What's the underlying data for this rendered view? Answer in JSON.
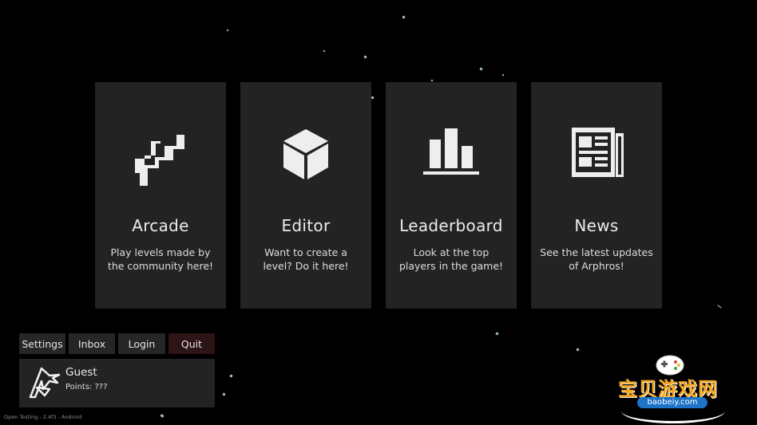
{
  "menu": {
    "cards": [
      {
        "title": "Arcade",
        "desc": "Play levels made by the community here!",
        "icon": "arcade-runner-icon"
      },
      {
        "title": "Editor",
        "desc": "Want to create a level? Do it here!",
        "icon": "cube-icon"
      },
      {
        "title": "Leaderboard",
        "desc": "Look at the top players in the game!",
        "icon": "bar-chart-icon"
      },
      {
        "title": "News",
        "desc": "See the latest updates of Arphros!",
        "icon": "newspaper-icon"
      }
    ]
  },
  "toolbar": {
    "settings_label": "Settings",
    "inbox_label": "Inbox",
    "login_label": "Login",
    "quit_label": "Quit"
  },
  "profile": {
    "name": "Guest",
    "points": "Points: ???",
    "avatar_icon": "arphros-logo-icon"
  },
  "footer": {
    "version": "Open Testing - 2.4f3 - Android"
  },
  "watermark": {
    "title": "宝贝游戏网",
    "domain": "baobeiy.com",
    "icon": "gamepad-icon"
  },
  "colors": {
    "background": "#000000",
    "card": "#232323",
    "button": "#262626",
    "quit": "#2d1416",
    "watermark_accent": "#f2a31b",
    "watermark_blue": "#1e73c8"
  }
}
